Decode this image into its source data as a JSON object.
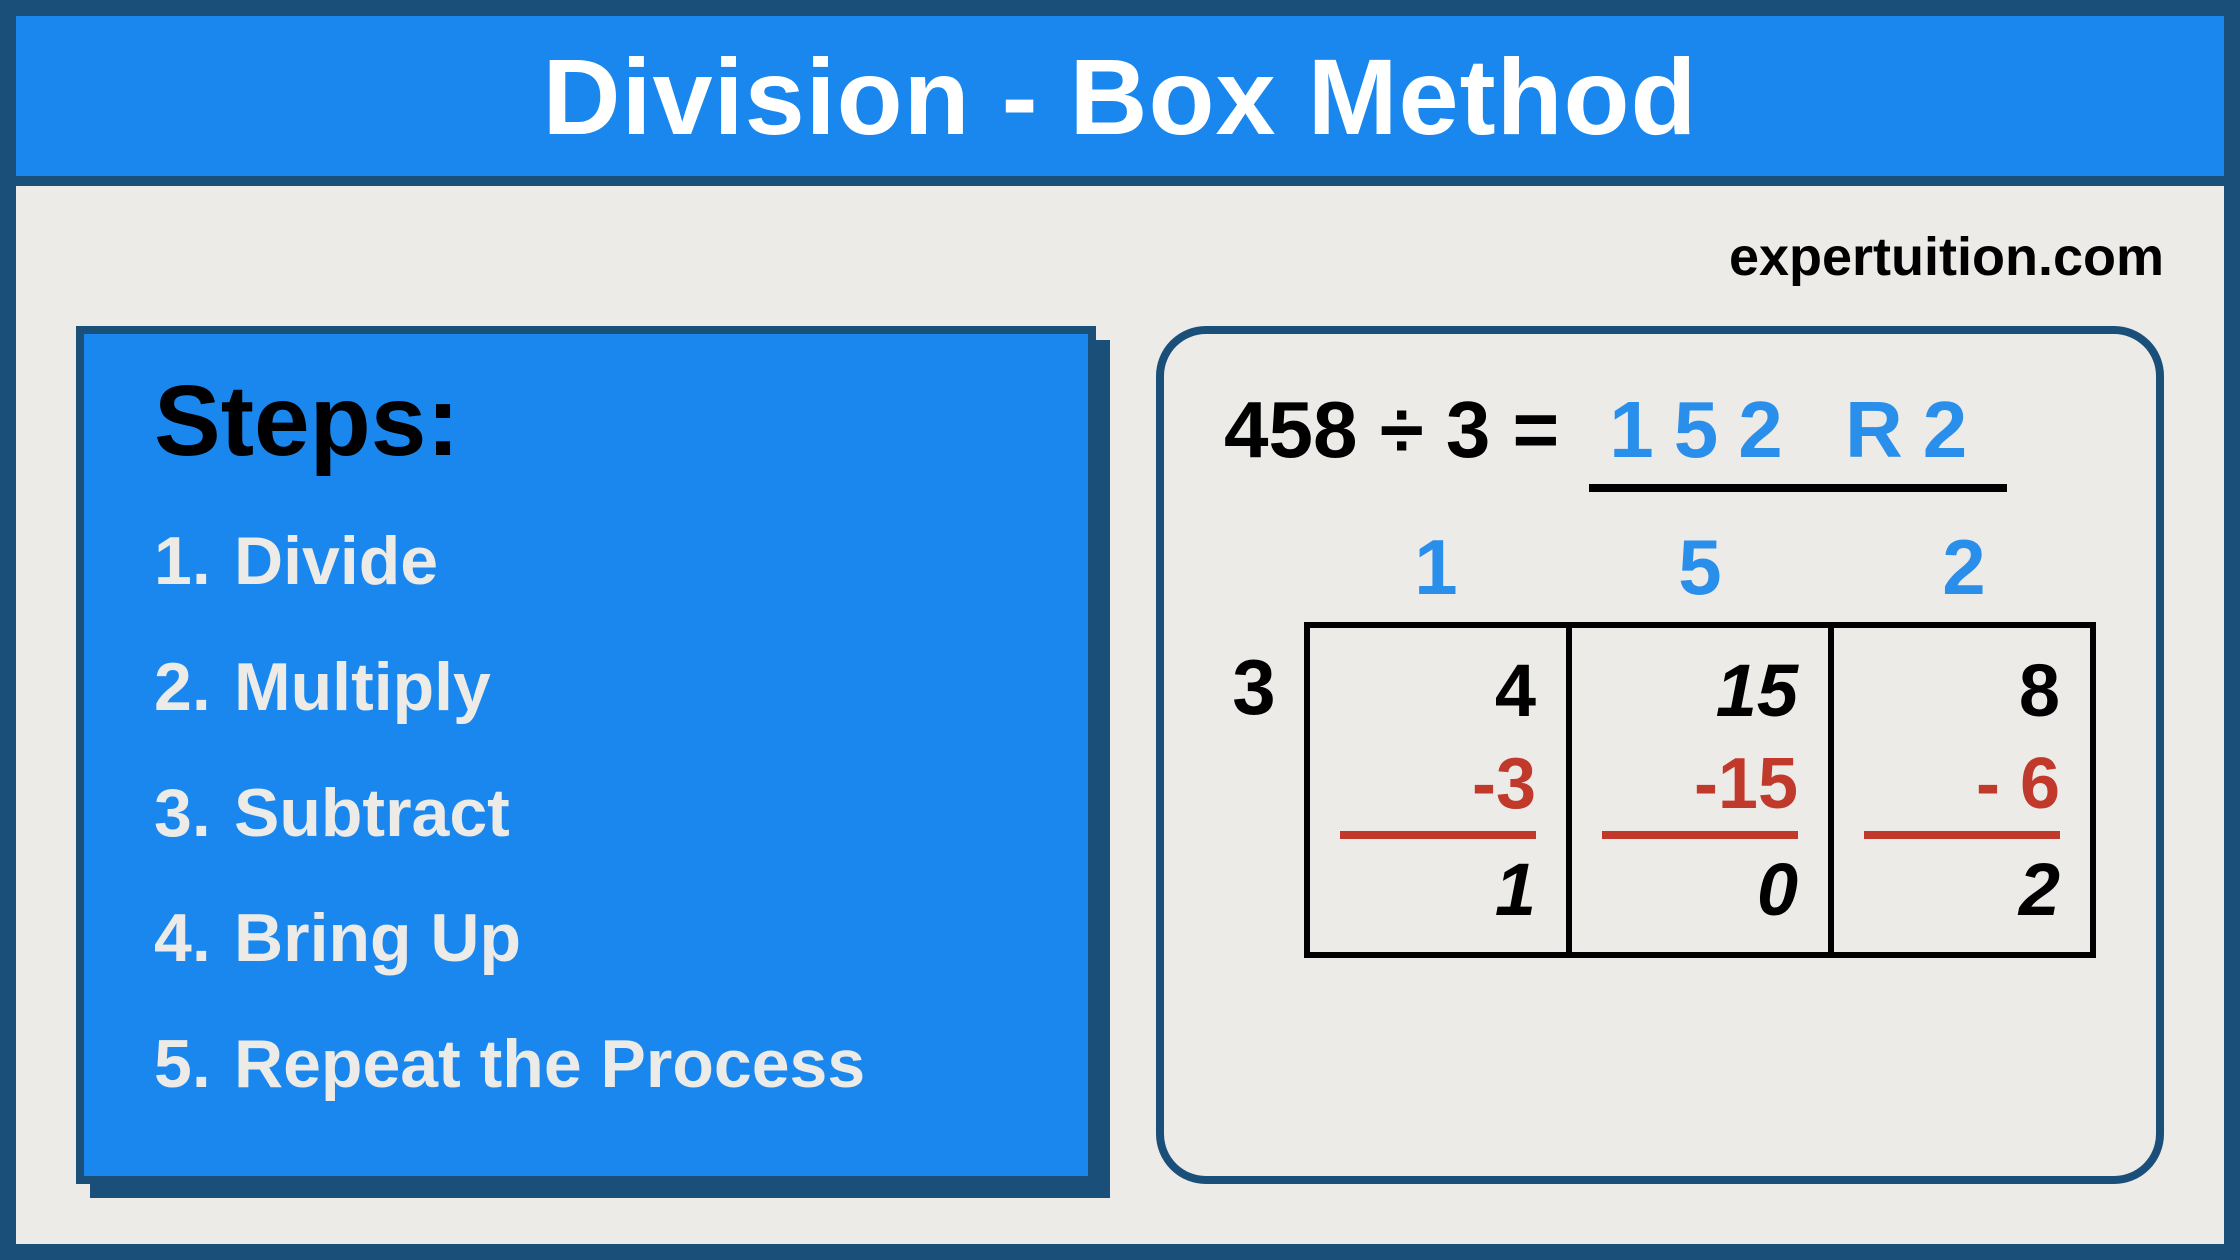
{
  "title": "Division - Box Method",
  "site": "expertuition.com",
  "steps_heading": "Steps:",
  "steps": [
    {
      "num": "1.",
      "label": "Divide"
    },
    {
      "num": "2.",
      "label": "Multiply"
    },
    {
      "num": "3.",
      "label": "Subtract"
    },
    {
      "num": "4.",
      "label": "Bring Up"
    },
    {
      "num": "5.",
      "label": "Repeat the Process"
    }
  ],
  "equation": {
    "lhs": "458 ÷ 3 =",
    "answer": "152 R2"
  },
  "divisor": "3",
  "quotients": [
    "1",
    "5",
    "2"
  ],
  "columns": [
    {
      "dividend": "4",
      "subtract": "-3",
      "remainder": "1"
    },
    {
      "dividend": "15",
      "subtract": "-15",
      "remainder": "0"
    },
    {
      "dividend": "8",
      "subtract": "- 6",
      "remainder": "2"
    }
  ]
}
